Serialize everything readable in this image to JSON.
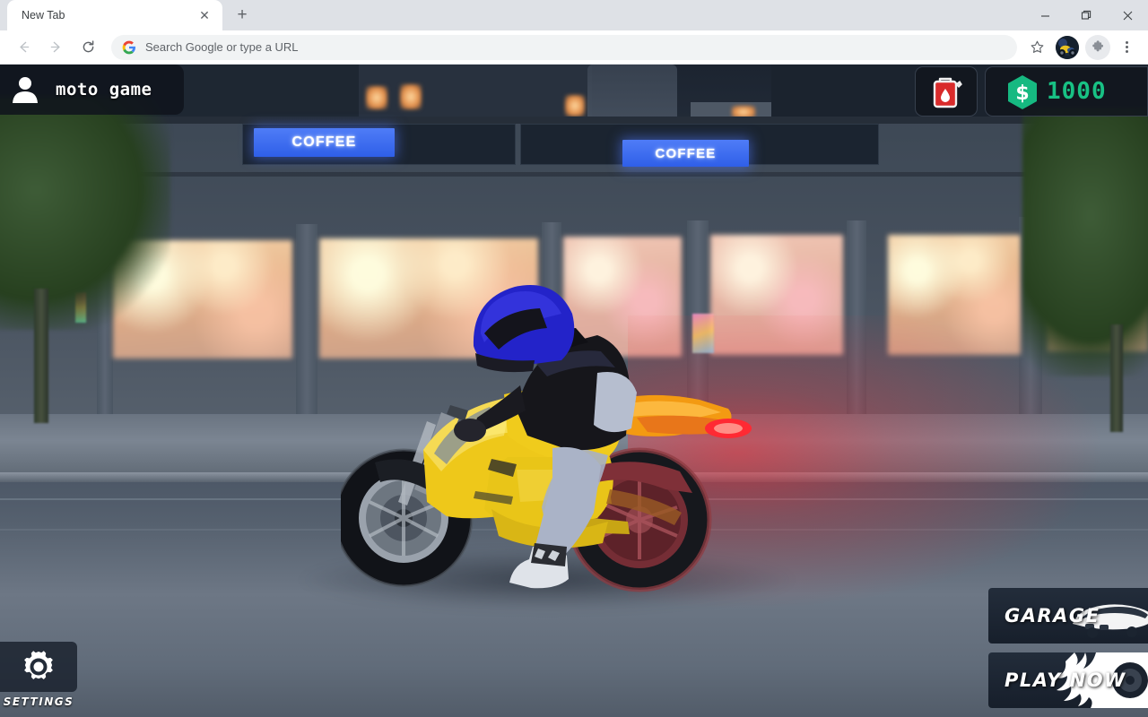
{
  "browser": {
    "tab": {
      "title": "New Tab",
      "close_icon": "close-icon"
    },
    "new_tab_icon": "plus-icon",
    "window_controls": {
      "minimize": "minimize-icon",
      "maximize": "maximize-icon",
      "close": "close-icon"
    },
    "nav": {
      "back_icon": "back-arrow-icon",
      "forward_icon": "forward-arrow-icon",
      "reload_icon": "reload-icon"
    },
    "omnibox": {
      "placeholder": "Search Google or type a URL",
      "value": "",
      "leading_icon": "google-g-icon"
    },
    "toolbar_right": {
      "bookmark_icon": "star-icon",
      "profile_icon": "avatar-icon",
      "extensions_icon": "puzzle-piece-icon",
      "menu_icon": "three-dot-menu-icon"
    }
  },
  "game": {
    "title_bar": {
      "avatar_icon": "person-icon",
      "player_name": "moto game"
    },
    "hud": {
      "fuel": {
        "icon": "fuel-can-icon",
        "label": ""
      },
      "coins": {
        "icon": "dollar-coin-icon",
        "value": "1000",
        "color": "#18c184"
      }
    },
    "settings": {
      "icon": "gear-icon",
      "label": "SETTINGS"
    },
    "menu_buttons": [
      {
        "label": "GARAGE",
        "icon": "car-icon"
      },
      {
        "label": "PLAY NOW",
        "icon": "wheel-flame-icon"
      }
    ],
    "scene": {
      "signs": [
        {
          "text": "COFFEE",
          "color": "#3f6cf2"
        },
        {
          "text": "COFFEE",
          "color": "#3f6cf2"
        }
      ],
      "vehicle": {
        "type": "sportbike",
        "body_color": "#f2c816",
        "rider_helmet_color": "#2222cc",
        "taillight_color": "#ff2a33"
      },
      "time_of_day": "night",
      "ground_color": "#6d7785"
    }
  }
}
